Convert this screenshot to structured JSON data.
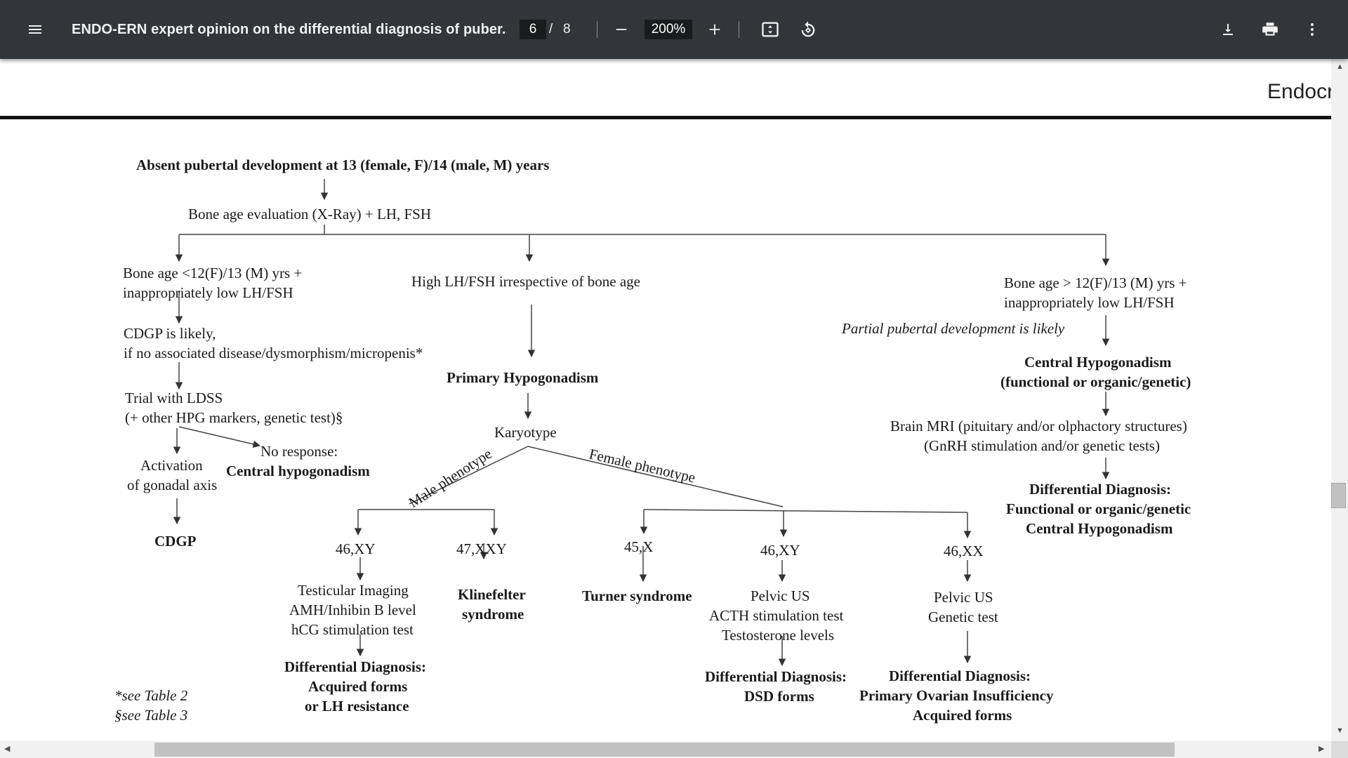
{
  "toolbar": {
    "title": "ENDO-ERN expert opinion on the differential diagnosis of puber...",
    "page_current": "6",
    "page_sep": "/",
    "page_total": "8",
    "zoom": "200%",
    "icons": [
      "menu-icon",
      "minus-icon",
      "plus-icon",
      "fit-page-icon",
      "rotate-icon",
      "download-icon",
      "print-icon",
      "more-vert-icon"
    ]
  },
  "page": {
    "journal_header": "Endocr"
  },
  "flowchart": {
    "start": "Absent pubertal development at 13 (female, F)/14 (male, M) years",
    "bone_age_eval": "Bone age evaluation (X-Ray) + LH, FSH",
    "left": {
      "condition_1": "Bone age <12(F)/13 (M) yrs +",
      "condition_2": "inappropriately low LH/FSH",
      "cdgp_likely_1": "CDGP is likely,",
      "cdgp_likely_2": "if no associated disease/dysmorphism/micropenis*",
      "trial_1": "Trial with LDSS",
      "trial_2": "(+ other HPG markers, genetic test)§",
      "activation_1": "Activation",
      "activation_2": "of gonadal axis",
      "no_response": "No response:",
      "central_hypo": "Central hypogonadism",
      "cdgp": "CDGP"
    },
    "middle": {
      "high_lh": "High LH/FSH irrespective of bone age",
      "primary_hypo": "Primary Hypogonadism",
      "karyotype": "Karyotype",
      "male_phenotype": "Male phenotype",
      "female_phenotype": "Female phenotype",
      "m_46xy": "46,XY",
      "m_47xxy": "47,XXY",
      "f_45x": "45,X",
      "f_46xy": "46,XY",
      "f_46xx": "46,XX",
      "testicular_1": "Testicular Imaging",
      "testicular_2": "AMH/Inhibin B level",
      "testicular_3": "hCG stimulation test",
      "klinefelter_1": "Klinefelter",
      "klinefelter_2": "syndrome",
      "turner": "Turner syndrome",
      "pelvic_us_1": "Pelvic US",
      "acth": "ACTH stimulation test",
      "testosterone": "Testosterone levels",
      "pelvic_us_2": "Pelvic US",
      "genetic_test": "Genetic test",
      "dd_acquired_1": "Differential Diagnosis:",
      "dd_acquired_2": "Acquired forms",
      "dd_acquired_3": "or LH resistance",
      "dd_dsd_1": "Differential Diagnosis:",
      "dd_dsd_2": "DSD forms",
      "dd_poi_1": "Differential Diagnosis:",
      "dd_poi_2": "Primary Ovarian Insufficiency",
      "dd_poi_3": "Acquired forms"
    },
    "right": {
      "condition_1": "Bone age > 12(F)/13 (M) yrs +",
      "condition_2": "inappropriately low LH/FSH",
      "partial": "Partial pubertal development is likely",
      "central_hypo_1": "Central Hypogonadism",
      "central_hypo_2": "(functional or organic/genetic)",
      "mri_1": "Brain MRI (pituitary and/or olphactory structures)",
      "mri_2": "(GnRH stimulation and/or genetic tests)",
      "dd_1": "Differential Diagnosis:",
      "dd_2": "Functional or organic/genetic",
      "dd_3": "Central Hypogonadism"
    },
    "footnotes": {
      "note_1": "*see Table 2",
      "note_2": "§see Table 3"
    }
  }
}
